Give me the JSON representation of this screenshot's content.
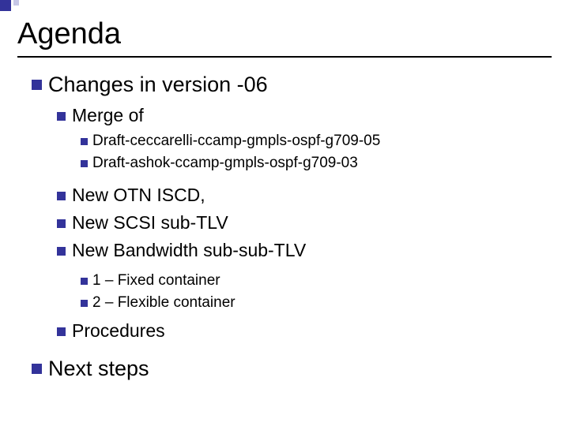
{
  "title": "Agenda",
  "l1_changes": "Changes in version -06",
  "l2_merge": "Merge of",
  "l3_draft1": "Draft-ceccarelli-ccamp-gmpls-ospf-g709-05",
  "l3_draft2": "Draft-ashok-ccamp-gmpls-ospf-g709-03",
  "l2_new1": "New OTN ISCD,",
  "l2_new2": "New SCSI sub-TLV",
  "l2_new3": "New Bandwidth sub-sub-TLV",
  "l3_c1": "1 – Fixed container",
  "l3_c2": "2 – Flexible container",
  "l2_proc": "Procedures",
  "l1_next": "Next steps"
}
